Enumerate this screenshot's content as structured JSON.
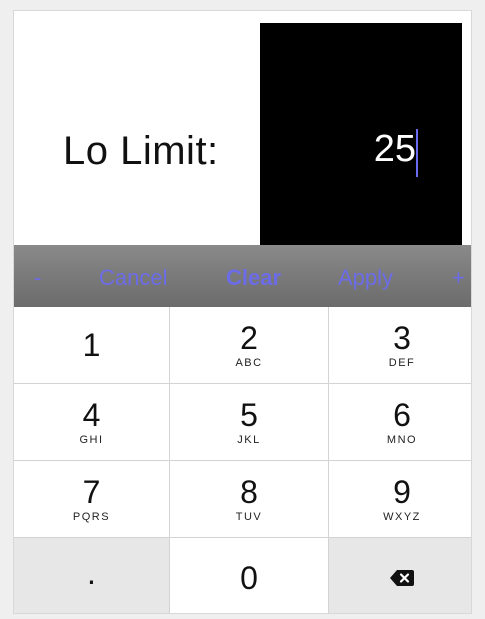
{
  "field": {
    "label": "Lo Limit:",
    "value": "25"
  },
  "toolbar": {
    "minus": "-",
    "cancel": "Cancel",
    "clear": "Clear",
    "apply": "Apply",
    "plus": "+"
  },
  "keypad": {
    "keys": [
      {
        "digit": "1",
        "letters": ""
      },
      {
        "digit": "2",
        "letters": "ABC"
      },
      {
        "digit": "3",
        "letters": "DEF"
      },
      {
        "digit": "4",
        "letters": "GHI"
      },
      {
        "digit": "5",
        "letters": "JKL"
      },
      {
        "digit": "6",
        "letters": "MNO"
      },
      {
        "digit": "7",
        "letters": "PQRS"
      },
      {
        "digit": "8",
        "letters": "TUV"
      },
      {
        "digit": "9",
        "letters": "WXYZ"
      }
    ],
    "dot": ".",
    "zero": "0",
    "delete_icon": "backspace-icon"
  },
  "colors": {
    "accent": "#6c6ce8",
    "toolbar": "#7a7a7a",
    "value_bg": "#000000"
  }
}
